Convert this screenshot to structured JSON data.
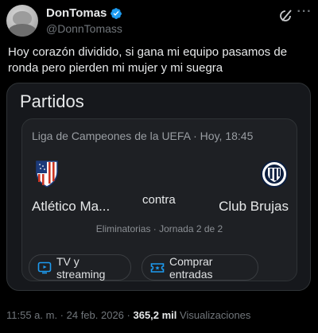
{
  "author": {
    "display_name": "DonTomas",
    "handle": "@DonnTomass",
    "verified": true
  },
  "tweet": {
    "text": "Hoy corazón dividido, si gana mi equipo pasamos de ronda pero pierden mi mujer y mi suegra"
  },
  "card": {
    "title": "Partidos",
    "match": {
      "competition_line": "Liga de Campeones de la UEFA · Hoy, 18:45",
      "home_team": "Atlético Ma...",
      "versus": "contra",
      "away_team": "Club Brujas",
      "stage": "Eliminatorias · Jornada 2 de 2",
      "actions": [
        {
          "label": "TV y streaming",
          "icon": "tv-icon"
        },
        {
          "label": "Comprar entradas",
          "icon": "ticket-icon"
        }
      ]
    }
  },
  "meta": {
    "timestamp": "11:55 a. m. · 24 feb. 2026",
    "separator": " · ",
    "views_count": "365,2 mil",
    "views_label": "Visualizaciones"
  },
  "colors": {
    "background": "#000000",
    "card_bg": "#16181c",
    "verified_blue": "#1d9bf0",
    "text_primary": "#e7e9ea",
    "text_secondary": "#71767b"
  }
}
